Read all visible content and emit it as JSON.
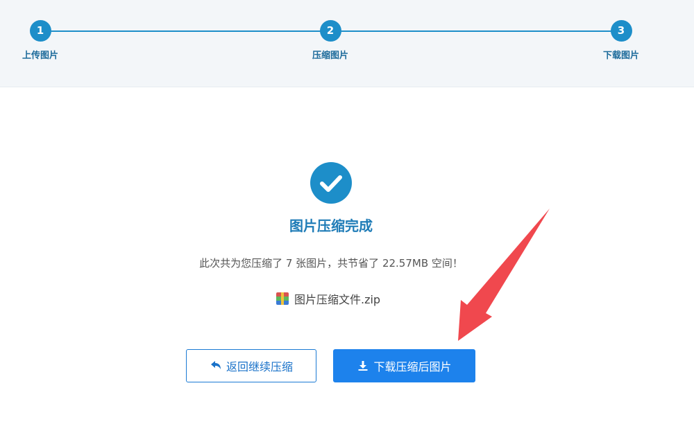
{
  "stepper": {
    "steps": [
      {
        "number": "1",
        "label": "上传图片"
      },
      {
        "number": "2",
        "label": "压缩图片"
      },
      {
        "number": "3",
        "label": "下载图片"
      }
    ],
    "current_step": 3
  },
  "result": {
    "icon": "check-circle-icon",
    "title": "图片压缩完成",
    "summary": "此次共为您压缩了 7 张图片，共节省了 22.57MB 空间！",
    "file_name": "图片压缩文件.zip",
    "file_icon": "zip-archive-icon"
  },
  "actions": {
    "back_label": "返回继续压缩",
    "back_icon": "undo-arrow-icon",
    "download_label": "下载压缩后图片",
    "download_icon": "download-icon"
  },
  "colors": {
    "accent": "#1d8ec9",
    "primary_button": "#1d82ec",
    "annotation_arrow": "#f0484e"
  }
}
